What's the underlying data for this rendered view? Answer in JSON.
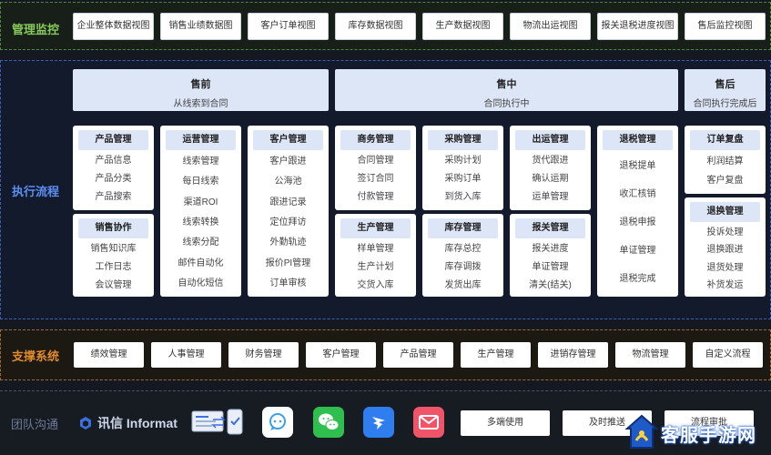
{
  "monitor": {
    "label": "管理监控",
    "buttons": [
      "企业整体数据视图",
      "销售业绩数据图",
      "客户订单视图",
      "库存数据视图",
      "生产数据视图",
      "物流出运视图",
      "报关退税进度视图",
      "售后监控视图"
    ]
  },
  "flow": {
    "label": "执行流程",
    "phases": [
      {
        "title": "售前",
        "sub": "从线索到合同"
      },
      {
        "title": "售中",
        "sub": "合同执行中"
      },
      {
        "title": "售后",
        "sub": "合同执行完成后"
      }
    ],
    "cards": {
      "product": {
        "title": "产品管理",
        "items": [
          "产品信息",
          "产品分类",
          "产品搜索"
        ]
      },
      "sales": {
        "title": "销售协作",
        "items": [
          "销售知识库",
          "工作日志",
          "会议管理"
        ]
      },
      "ops": {
        "title": "运营管理",
        "items": [
          "线索管理",
          "每日线索",
          "渠道ROI",
          "线索转换",
          "线索分配",
          "邮件自动化",
          "自动化短信"
        ]
      },
      "customer": {
        "title": "客户管理",
        "items": [
          "客户跟进",
          "公海池",
          "跟进记录",
          "定位拜访",
          "外勤轨迹",
          "报价PI管理",
          "订单审核"
        ]
      },
      "business": {
        "title": "商务管理",
        "items": [
          "合同管理",
          "签订合同",
          "付款管理"
        ]
      },
      "production": {
        "title": "生产管理",
        "items": [
          "样单管理",
          "生产计划",
          "交货入库"
        ]
      },
      "purchase": {
        "title": "采购管理",
        "items": [
          "采购计划",
          "采购订单",
          "到货入库"
        ]
      },
      "inventory": {
        "title": "库存管理",
        "items": [
          "库存总控",
          "库存调拨",
          "发货出库"
        ]
      },
      "shipping": {
        "title": "出运管理",
        "items": [
          "货代跟进",
          "确认运期",
          "运单管理"
        ]
      },
      "customs": {
        "title": "报关管理",
        "items": [
          "报关进度",
          "单证管理",
          "清关(结关)"
        ]
      },
      "tax": {
        "title": "退税管理",
        "items": [
          "退税提单",
          "收汇核销",
          "退税申报",
          "单证管理",
          "退税完成"
        ]
      },
      "review": {
        "title": "订单复盘",
        "items": [
          "利润结算",
          "客户复盘"
        ]
      },
      "returns": {
        "title": "退换管理",
        "items": [
          "投诉处理",
          "退换跟进",
          "退货处理",
          "补货发运"
        ]
      }
    }
  },
  "support": {
    "label": "支撑系统",
    "buttons": [
      "绩效管理",
      "人事管理",
      "财务管理",
      "客户管理",
      "产品管理",
      "生产管理",
      "进销存管理",
      "物流管理",
      "自定义流程"
    ]
  },
  "team": {
    "label": "团队沟通",
    "brand": "讯信 Informat",
    "buttons": [
      "多端使用",
      "及时推送",
      "流程审批"
    ],
    "icons": [
      "desktop-sync-icon",
      "chat-bubble-icon",
      "wechat-icon",
      "dingtalk-icon",
      "email-icon"
    ]
  },
  "watermark": "客服手游网",
  "colors": {
    "monitor": "#86c95c",
    "flow": "#5b8ef0",
    "support": "#e08a2e",
    "team": "#6f7c97"
  }
}
